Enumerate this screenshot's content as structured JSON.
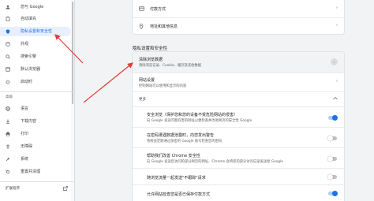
{
  "sidebar": {
    "items": [
      {
        "label": "您与 Google",
        "icon": "person-icon"
      },
      {
        "label": "自动填充",
        "icon": "clipboard-icon"
      },
      {
        "label": "隐私设置和安全性",
        "icon": "shield-icon",
        "active": true
      },
      {
        "label": "外观",
        "icon": "palette-icon"
      },
      {
        "label": "搜索引擎",
        "icon": "search-icon"
      },
      {
        "label": "默认浏览器",
        "icon": "browser-icon"
      },
      {
        "label": "启动时",
        "icon": "power-icon"
      }
    ],
    "advanced_label": "高级",
    "advanced_items": [
      {
        "label": "语言",
        "icon": "globe-icon"
      },
      {
        "label": "下载内容",
        "icon": "download-icon"
      },
      {
        "label": "打印",
        "icon": "printer-icon"
      },
      {
        "label": "无障碍",
        "icon": "accessibility-icon"
      },
      {
        "label": "系统",
        "icon": "wrench-icon"
      },
      {
        "label": "重置并清理",
        "icon": "reset-icon"
      }
    ],
    "extensions_label": "扩展程序"
  },
  "autofill_card": {
    "rows": [
      {
        "label": "付款方式",
        "icon": "credit-card-icon"
      },
      {
        "label": "地址和其他信息",
        "icon": "location-pin-icon"
      }
    ]
  },
  "privacy": {
    "section_title": "隐私设置和安全性",
    "clear_data": {
      "title": "清除浏览数据",
      "subtitle": "清除浏览记录、Cookie、缓存及其他数据"
    },
    "site_settings": {
      "title": "网站设置",
      "subtitle": "控制网站可以使用和显示的内容"
    },
    "more_label": "更多",
    "more_rows": [
      {
        "title": "安全浏览（保护您和您的设备不受危险网站的侵害）",
        "subtitle": "向 Google 发送可能有害的网址以便检查并改进网页的安全性 Google",
        "toggle": "on"
      },
      {
        "title": "在密码遭遇数据泄露时，向您发出警告",
        "subtitle": "系统会定期通过加密的 Google 账号检查您的密码",
        "toggle": "off"
      },
      {
        "title": "帮助我们改善 Chrome 安全性",
        "subtitle": "向 Google 发送您访问的部分网页的网址、Chrome 会将您的部分访问记录发送给 Google",
        "toggle": "off"
      },
      {
        "title": "随浏览流量一起发送\"不跟踪\"请求",
        "subtitle": "",
        "toggle": "off"
      },
      {
        "title": "允许网站检查您是否已保存付款方式",
        "subtitle": "",
        "toggle": "on"
      }
    ]
  },
  "colors": {
    "accent": "#1a73e8",
    "annotation_arrow": "#e53935"
  }
}
